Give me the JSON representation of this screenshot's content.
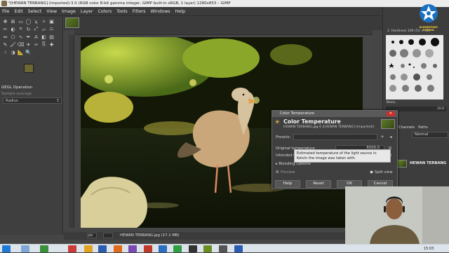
{
  "window": {
    "title": "*[HEWAN TERBANG] (imported)-3.0 (RGB color 8-bit gamma integer, GIMP built-in sRGB, 1 layer) 1280x853 – GIMP"
  },
  "menubar": [
    "File",
    "Edit",
    "Select",
    "View",
    "Image",
    "Layer",
    "Colors",
    "Tools",
    "Filters",
    "Windows",
    "Help"
  ],
  "tool_options": {
    "title": "GEGL Operation",
    "sample_average": "Sample average",
    "radius_label": "Radius",
    "radius_value": "3"
  },
  "colors": {
    "foreground": "#6e6734",
    "background": "#e8e8e8",
    "dialog_close": "#c9302c"
  },
  "statusbar": {
    "unit": "px",
    "zoom": "",
    "file": "HEWAN TERBANG.jpg (17.1 MB)"
  },
  "right_dock": {
    "brush_label": "2. Hardness 100 (51 × 51)",
    "brush_set": "Basic,",
    "brush_size": "10.0",
    "tabs": [
      "Channels",
      "Paths"
    ],
    "mode": "Normal",
    "layer_name": "HEWAN TERBANG"
  },
  "watermark": {
    "text": "ELEMENTARY SCHOOL"
  },
  "taskbar": {
    "clock": "15:03"
  },
  "dialog": {
    "window_title": "Color Temperature",
    "heading": "Color Temperature",
    "subheading": "HEWAN TERBANG.jpg-6 ([HEWAN TERBANG] (imported))",
    "presets_label": "Presets:",
    "original_temperature_label": "Original temperature",
    "original_temperature_value": "6500.0",
    "intended_temperature_label": "Intended te",
    "tooltip": "Estimated temperature of the light source in Kelvin the image was taken with.",
    "blending_options": "Blending Options",
    "preview_label": "Preview",
    "split_view_label": "Split view",
    "buttons": [
      "Help",
      "Reset",
      "OK",
      "Cancel"
    ]
  }
}
